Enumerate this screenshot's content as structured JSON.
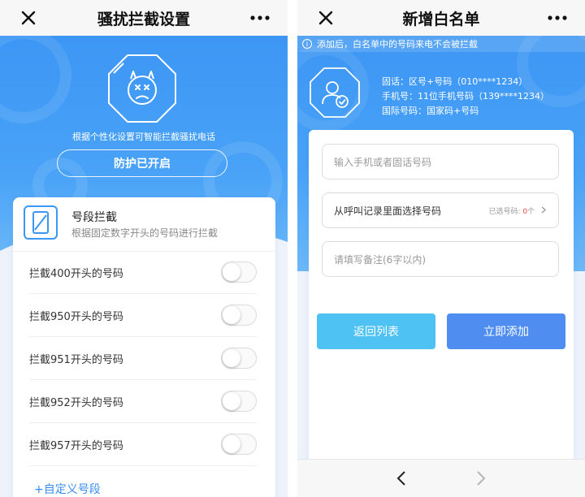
{
  "left": {
    "nav": {
      "title": "骚扰拦截设置"
    },
    "hero": {
      "subtitle": "根据个性化设置可智能拦截骚扰电话",
      "protect_label": "防护已开启"
    },
    "card": {
      "title": "号段拦截",
      "description": "根据固定数字开头的号码进行拦截",
      "rules": [
        {
          "label": "拦截400开头的号码",
          "enabled": false
        },
        {
          "label": "拦截950开头的号码",
          "enabled": false
        },
        {
          "label": "拦截951开头的号码",
          "enabled": false
        },
        {
          "label": "拦截952开头的号码",
          "enabled": false
        },
        {
          "label": "拦截957开头的号码",
          "enabled": false
        }
      ],
      "custom_label": "+自定义号段"
    }
  },
  "right": {
    "nav": {
      "title": "新增白名单"
    },
    "info": "添加后，白名单中的号码来电不会被拦截",
    "formats": [
      "固话：区号+号码（010****1234）",
      "手机号：11位手机号码（139****1234）",
      "国际号码：国家码+号码"
    ],
    "form": {
      "phone_placeholder": "输入手机或者固话号码",
      "select_label": "从呼叫记录里面选择号码",
      "selected_prefix": "已选号码:",
      "selected_count": "0",
      "selected_suffix": "个",
      "note_placeholder": "请填写备注(6字以内)",
      "back_label": "返回列表",
      "add_label": "立即添加"
    }
  },
  "colors": {
    "primary_blue": "#3c96f4",
    "back_button": "#4ec2f3",
    "add_button": "#4f8ef0",
    "link_blue": "#3a8df0",
    "count_red": "#f5474d"
  },
  "icons": [
    "close-icon",
    "more-icon",
    "angry-face-shield-icon",
    "phone-segment-icon",
    "user-check-shield-icon",
    "info-icon",
    "chevron-right-icon",
    "back-arrow-icon",
    "forward-arrow-icon"
  ]
}
